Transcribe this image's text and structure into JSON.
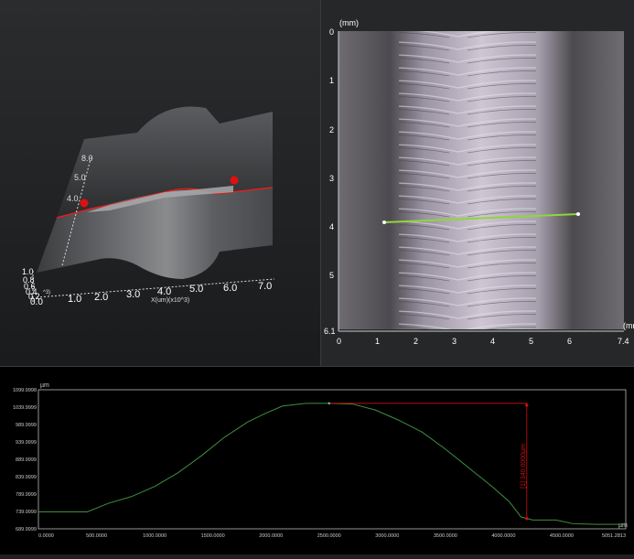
{
  "view3d": {
    "x_axis_label": "X(um)(x10^3)",
    "x_ticks": [
      "1.0",
      "2.0",
      "3.0",
      "4.0",
      "5.0",
      "6.0",
      "7.0"
    ],
    "y_ticks": [
      "4.0",
      "5.0",
      "8.0"
    ],
    "z_ticks": [
      "1.0",
      "0.8",
      "0.6",
      "0.4",
      "0.2",
      "0.0"
    ],
    "y_exp": "^3)"
  },
  "view2d": {
    "unit_top": "(mm)",
    "unit_right": "(mm)",
    "y_ticks": [
      "0",
      "1",
      "2",
      "3",
      "4",
      "5",
      "6.1"
    ],
    "x_ticks": [
      "0",
      "1",
      "2",
      "3",
      "4",
      "5",
      "6",
      "7.4"
    ]
  },
  "profile": {
    "unit_y": "µm",
    "unit_x": "µm",
    "y_ticks": [
      "1099.9998",
      "1039.9999",
      "989.9999",
      "939.9999",
      "889.9999",
      "839.9999",
      "789.9999",
      "739.9999",
      "689.9999"
    ],
    "x_ticks": [
      "0.0000",
      "500.0000",
      "1000.0000",
      "1500.0000",
      "2000.0000",
      "2500.0000",
      "3000.0000",
      "3500.0000",
      "4000.0000",
      "4500.0000",
      "5051.2813"
    ],
    "measurement": "[1] 340.0000µm",
    "line_color": "#3f8f3f",
    "measure_color": "#d01010"
  },
  "chart_data": {
    "type": "line",
    "title": "",
    "xlabel": "µm",
    "ylabel": "µm",
    "xlim": [
      0,
      5051.2813
    ],
    "ylim": [
      689.9999,
      1099.9998
    ],
    "x": [
      0,
      420,
      600,
      800,
      1000,
      1200,
      1400,
      1600,
      1800,
      1950,
      2100,
      2300,
      2500,
      2700,
      2900,
      3100,
      3300,
      3500,
      3700,
      3900,
      4050,
      4150,
      4250,
      4450,
      4600,
      4800,
      5051
    ],
    "series": [
      {
        "values": [
          740,
          740,
          765,
          785,
          815,
          855,
          905,
          960,
          1005,
          1030,
          1052,
          1060,
          1060,
          1058,
          1040,
          1010,
          975,
          925,
          870,
          815,
          770,
          725,
          716,
          716,
          705,
          703,
          703
        ]
      }
    ],
    "annotation": {
      "x": 4200,
      "y_top": 1060,
      "y_bottom": 720,
      "label": "[1] 340.0000µm"
    }
  }
}
